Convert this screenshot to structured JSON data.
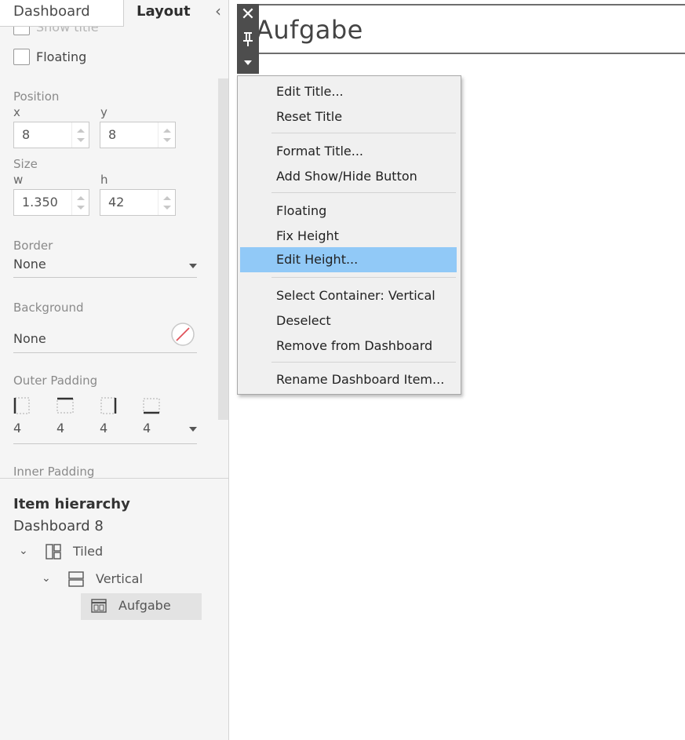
{
  "tabs": {
    "dashboard": "Dashboard",
    "layout": "Layout"
  },
  "layout_panel": {
    "show_title": "Show title",
    "floating": "Floating",
    "position": {
      "label": "Position",
      "x_label": "x",
      "y_label": "y",
      "x": "8",
      "y": "8"
    },
    "size": {
      "label": "Size",
      "w_label": "w",
      "h_label": "h",
      "w": "1.350",
      "h": "42"
    },
    "border": {
      "label": "Border",
      "value": "None"
    },
    "background": {
      "label": "Background",
      "value": "None"
    },
    "outer_padding": {
      "label": "Outer Padding",
      "left": "4",
      "top": "4",
      "right": "4",
      "bottom": "4"
    },
    "inner_padding": {
      "label": "Inner Padding"
    }
  },
  "hierarchy": {
    "title": "Item hierarchy",
    "dashboard": "Dashboard 8",
    "items": [
      {
        "label": "Tiled"
      },
      {
        "label": "Vertical"
      },
      {
        "label": "Aufgabe"
      }
    ]
  },
  "title_object": {
    "text": "Aufgabe"
  },
  "context_menu": {
    "items": [
      {
        "label": "Edit Title..."
      },
      {
        "label": "Reset Title"
      },
      {
        "label": "Format Title..."
      },
      {
        "label": "Add Show/Hide Button"
      },
      {
        "label": "Floating"
      },
      {
        "label": "Fix Height"
      },
      {
        "label": "Edit Height...",
        "highlighted": true
      },
      {
        "label": "Select Container: Vertical"
      },
      {
        "label": "Deselect"
      },
      {
        "label": "Remove from Dashboard"
      },
      {
        "label": "Rename Dashboard Item..."
      }
    ]
  },
  "colors": {
    "highlight": "#91c9f7",
    "toolbar": "#4d4d4d",
    "selected_row": "#e3e3e3"
  }
}
